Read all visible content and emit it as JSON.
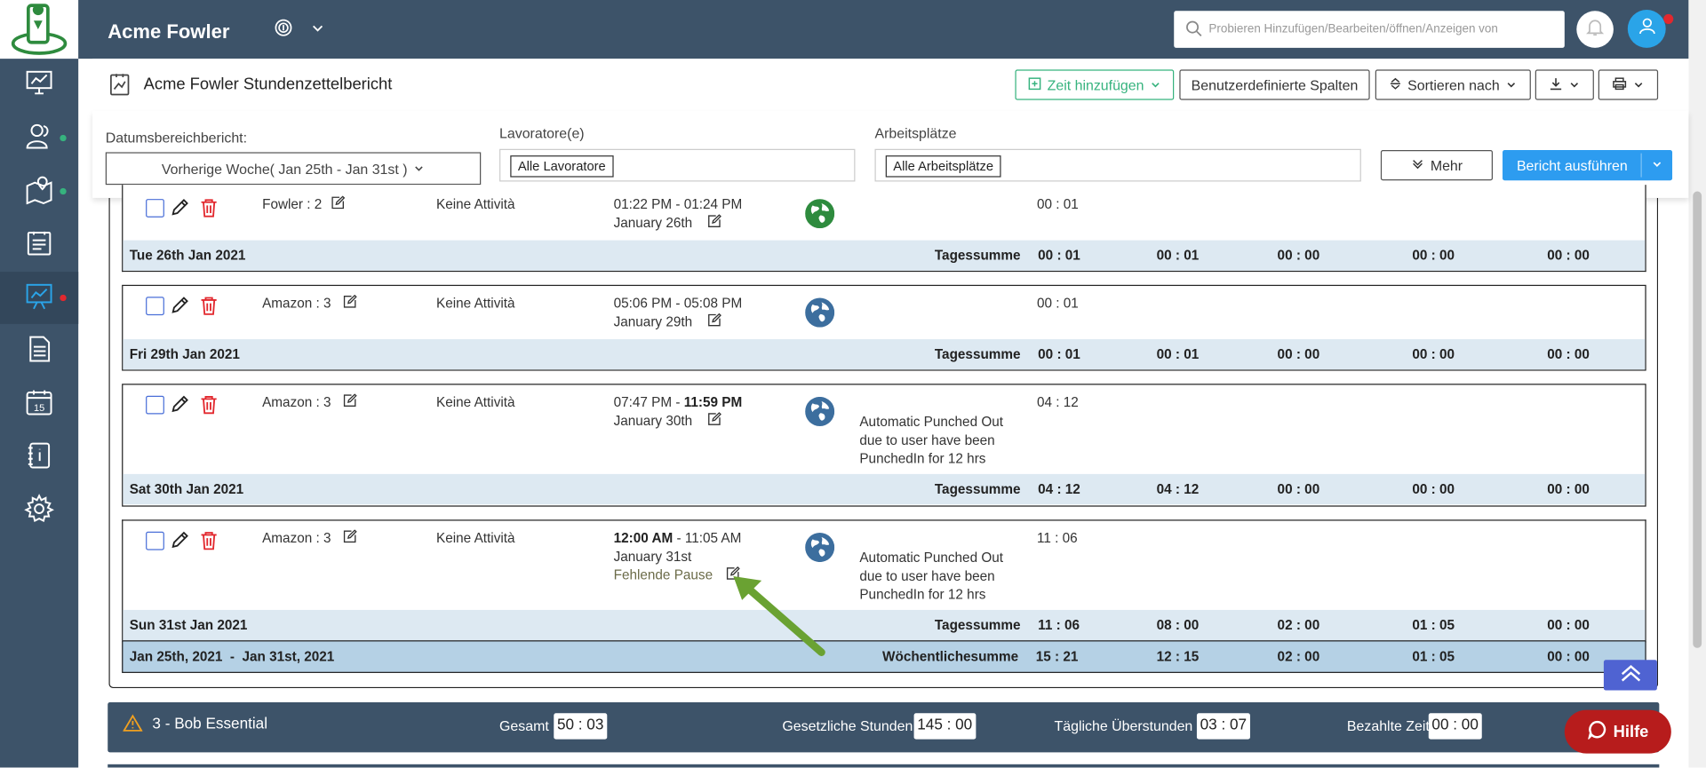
{
  "app": {
    "brand": "Acme Fowler",
    "search_placeholder": "Probieren Hinzufügen/Bearbeiten/öffnen/Anzeigen von"
  },
  "report": {
    "title": "Acme Fowler Stundenzettelbericht",
    "add_time": "Zeit hinzufügen",
    "custom_columns": "Benutzerdefinierte Spalten",
    "sort_by": "Sortieren nach"
  },
  "filters": {
    "date_label": "Datumsbereichbericht:",
    "date_value": "Vorherige Woche( Jan 25th - Jan 31st )",
    "workers_label": "Lavoratore(e)",
    "workers_tag": "Alle Lavoratore",
    "sites_label": "Arbeitsplätze",
    "sites_tag": "Alle Arbeitsplätze",
    "more": "Mehr",
    "run": "Bericht ausführen"
  },
  "entries": [
    {
      "job": "Fowler : 2",
      "activity": "Keine Attività",
      "time_start": "01:22 PM",
      "time_sep": " - ",
      "time_end": "01:24 PM",
      "date": "January 26th",
      "note": "",
      "break": "",
      "duration": "00 : 01",
      "day": "Tue 26th Jan 2021",
      "sum_label": "Tagessumme",
      "sums": [
        "00 : 01",
        "00 : 01",
        "00 : 00",
        "00 : 00",
        "00 : 00"
      ]
    },
    {
      "job": "Amazon : 3",
      "activity": "Keine Attività",
      "time_start": "05:06 PM",
      "time_sep": " - ",
      "time_end": "05:08 PM",
      "date": "January 29th",
      "note": "",
      "break": "",
      "duration": "00 : 01",
      "day": "Fri 29th Jan 2021",
      "sum_label": "Tagessumme",
      "sums": [
        "00 : 01",
        "00 : 01",
        "00 : 00",
        "00 : 00",
        "00 : 00"
      ]
    },
    {
      "job": "Amazon : 3",
      "activity": "Keine Attività",
      "time_start": "07:47 PM",
      "time_sep": " - ",
      "time_end": "11:59 PM",
      "date": "January 30th",
      "note": "Automatic Punched Out due to user have been PunchedIn for 12 hrs",
      "break": "",
      "duration": "04 : 12",
      "day": "Sat 30th Jan 2021",
      "sum_label": "Tagessumme",
      "sums": [
        "04 : 12",
        "04 : 12",
        "00 : 00",
        "00 : 00",
        "00 : 00"
      ]
    },
    {
      "job": "Amazon : 3",
      "activity": "Keine Attività",
      "time_start": "12:00 AM",
      "time_sep": " - ",
      "time_end": "11:05 AM",
      "date": "January 31st",
      "note": "Automatic Punched Out due to user have been PunchedIn for 12 hrs",
      "break": "Fehlende Pause",
      "duration": "11 : 06",
      "day": "Sun 31st Jan 2021",
      "sum_label": "Tagessumme",
      "sums": [
        "11 : 06",
        "08 : 00",
        "02 : 00",
        "01 : 05",
        "00 : 00"
      ]
    }
  ],
  "week": {
    "range_start": "Jan 25th, 2021",
    "range_sep": "-",
    "range_end": "Jan 31st, 2021",
    "label": "Wöchentlichesumme",
    "sums": [
      "15 : 21",
      "12 : 15",
      "02 : 00",
      "01 : 05",
      "00 : 00"
    ]
  },
  "employee": {
    "name": "3 - Bob Essential",
    "total_label": "Gesamt",
    "total": "50 : 03",
    "legal_label": "Gesetzliche Stunden",
    "legal": "145 : 00",
    "overtime_label": "Tägliche Überstunden",
    "overtime": "03 : 07",
    "paid_label": "Bezahlte Zeit",
    "paid": "00 : 00"
  },
  "help": {
    "label": "Hilfe"
  },
  "colors": {
    "sidebar": "#3d5369",
    "accent": "#2d9cf0",
    "green": "#36b37e",
    "delete": "#e2282e",
    "summary": "#dde9f2",
    "week": "#b5d1e5"
  }
}
